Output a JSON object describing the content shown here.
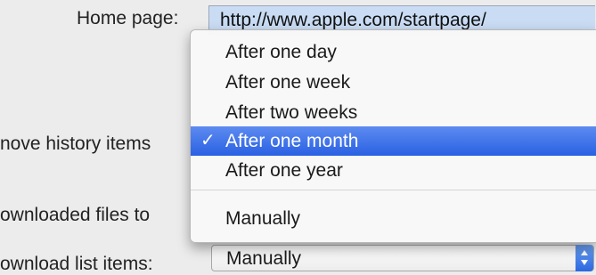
{
  "labels": {
    "home_page": "Home page:",
    "remove_history": "nove history items",
    "downloaded_files": "ownloaded files to",
    "download_list": "ownload list items:"
  },
  "home_page": {
    "value": "http://www.apple.com/startpage/"
  },
  "history_menu": {
    "items": [
      {
        "label": "After one day"
      },
      {
        "label": "After one week"
      },
      {
        "label": "After two weeks"
      },
      {
        "label": "After one month",
        "selected": true
      },
      {
        "label": "After one year"
      },
      {
        "label": "Manually"
      }
    ],
    "check_glyph": "✓"
  },
  "download_list_popup": {
    "value": "Manually"
  },
  "colors": {
    "selection": "#2a61e3",
    "field_highlight": "#c9dcf4"
  }
}
